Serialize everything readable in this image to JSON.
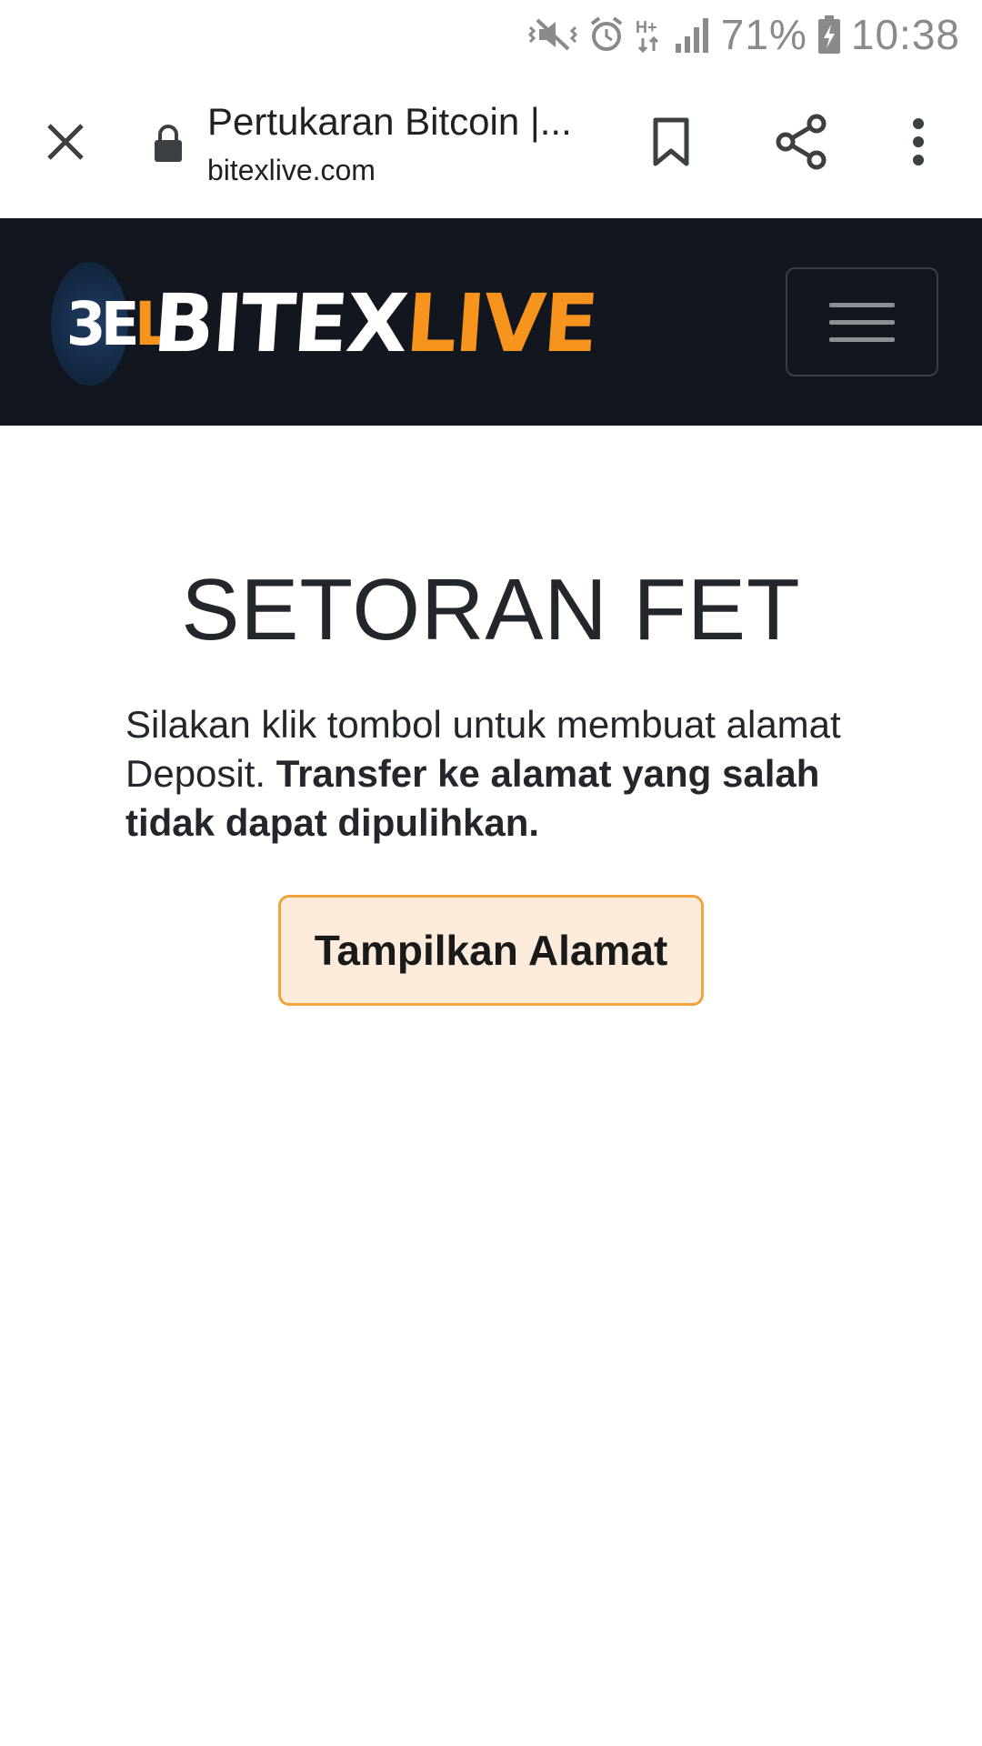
{
  "status_bar": {
    "battery": "71%",
    "time": "10:38",
    "network_label": "H+",
    "icons": [
      "mute-vibrate-icon",
      "alarm-icon",
      "network-h-plus-icon",
      "signal-icon",
      "battery-charging-icon"
    ]
  },
  "browser": {
    "page_title": "Pertukaran Bitcoin |...",
    "url": "bitexlive.com",
    "icons": [
      "close-icon",
      "lock-icon",
      "bookmark-icon",
      "share-icon",
      "more-vert-icon"
    ]
  },
  "site": {
    "logo": {
      "mark_white": "3E",
      "mark_orange": "L",
      "word_white": "BITEX",
      "word_orange": "LIVE"
    },
    "navbar_color": "#12161e",
    "accent_color": "#f7941d"
  },
  "main": {
    "title": "SETORAN FET",
    "description_regular": "Silakan klik tombol untuk membuat alamat Deposit.",
    "description_bold": "Transfer ke alamat yang salah tidak dapat dipulihkan.",
    "button_label": "Tampilkan Alamat"
  }
}
